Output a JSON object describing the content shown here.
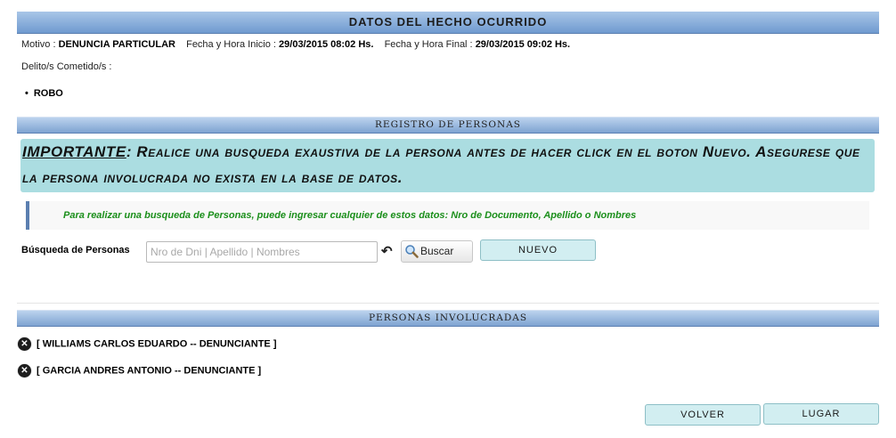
{
  "hecho": {
    "title": "DATOS DEL HECHO OCURRIDO",
    "motivo_label": "Motivo :",
    "motivo_value": "DENUNCIA PARTICULAR",
    "fecha_inicio_label": "Fecha y Hora Inicio :",
    "fecha_inicio_value": "29/03/2015 08:02 Hs.",
    "fecha_final_label": "Fecha y Hora Final :",
    "fecha_final_value": "29/03/2015 09:02 Hs.",
    "delitos_label": "Delito/s Cometido/s :",
    "delitos": [
      "ROBO"
    ]
  },
  "registro": {
    "title": "REGISTRO DE PERSONAS",
    "important_title": "IMPORTANTE",
    "important_text": ": Realice una busqueda exaustiva de la persona antes de hacer click en el boton Nuevo. Asegurese que la persona involucrada no exista en la base de datos.",
    "hint": "Para realizar una busqueda de Personas, puede ingresar cualquier de estos datos: Nro de Documento, Apellido o Nombres",
    "search_label": "Búsqueda de Personas",
    "search_placeholder": "Nro de Dni | Apellido | Nombres",
    "search_value": "",
    "reset_icon": "undo-icon",
    "buscar_label": "Buscar",
    "buscar_icon": "magnifier-icon",
    "nuevo_label": "NUEVO"
  },
  "involucradas": {
    "title": "PERSONAS INVOLUCRADAS",
    "items": [
      "[ WILLIAMS CARLOS EDUARDO -- DENUNCIANTE ]",
      "[ GARCIA ANDRES ANTONIO -- DENUNCIANTE ]"
    ]
  },
  "footer": {
    "volver_label": "VOLVER",
    "lugar_label": "LUGAR"
  },
  "colors": {
    "header_bar": "#6f9ad0",
    "important_bg": "#abdde1",
    "hint_text": "#1b8f1b",
    "button_bg": "#d2eef1"
  }
}
